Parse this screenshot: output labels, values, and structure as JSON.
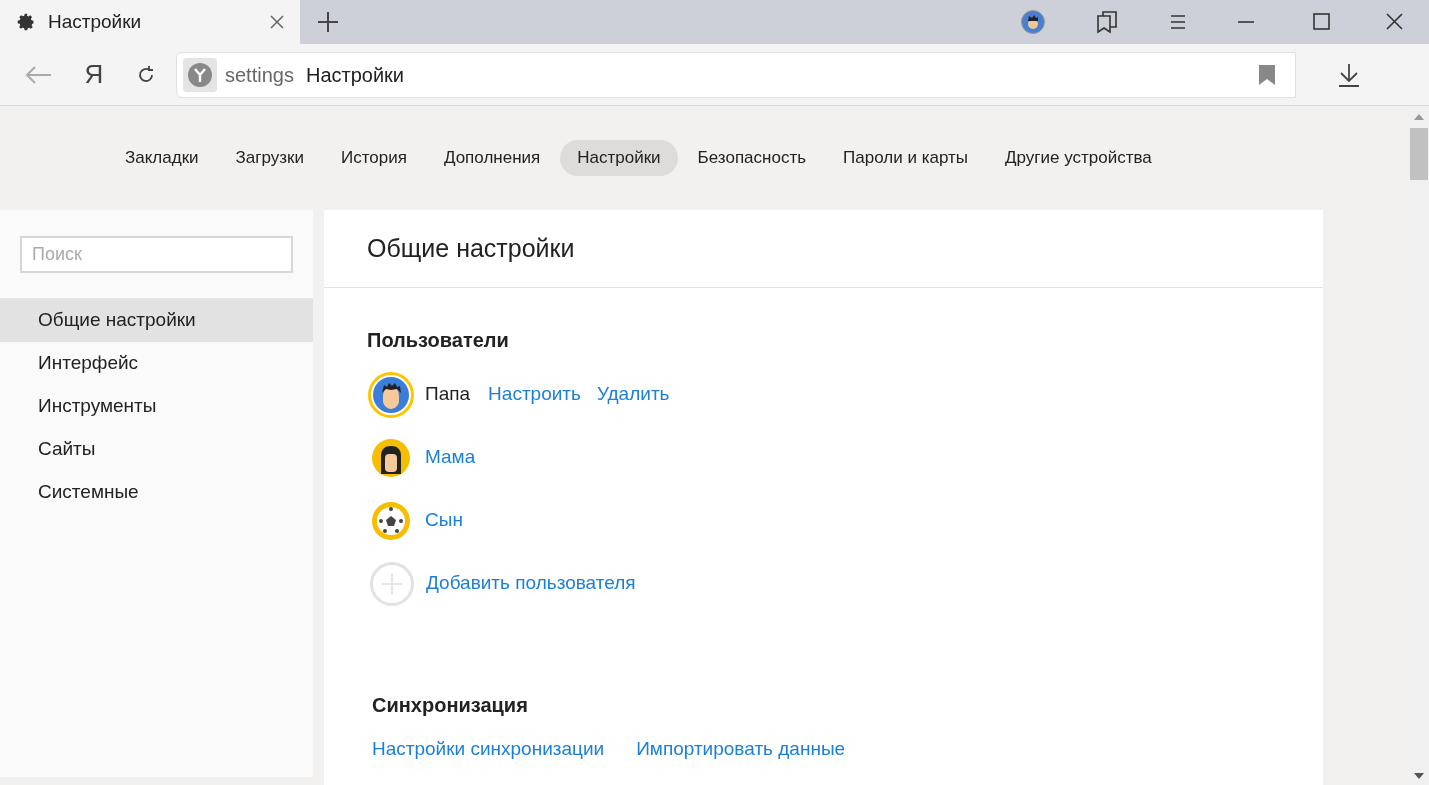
{
  "tab": {
    "title": "Настройки"
  },
  "toolbar": {
    "logo_letter": "Я",
    "address_scheme": "settings",
    "address_title": "Настройки"
  },
  "nav": [
    {
      "label": "Закладки",
      "selected": false
    },
    {
      "label": "Загрузки",
      "selected": false
    },
    {
      "label": "История",
      "selected": false
    },
    {
      "label": "Дополнения",
      "selected": false
    },
    {
      "label": "Настройки",
      "selected": true
    },
    {
      "label": "Безопасность",
      "selected": false
    },
    {
      "label": "Пароли и карты",
      "selected": false
    },
    {
      "label": "Другие устройства",
      "selected": false
    }
  ],
  "sidebar": {
    "search_placeholder": "Поиск",
    "items": [
      {
        "label": "Общие настройки",
        "selected": true
      },
      {
        "label": "Интерфейс",
        "selected": false
      },
      {
        "label": "Инструменты",
        "selected": false
      },
      {
        "label": "Сайты",
        "selected": false
      },
      {
        "label": "Системные",
        "selected": false
      }
    ]
  },
  "main": {
    "title": "Общие настройки",
    "users_heading": "Пользователи",
    "users": [
      {
        "name": "Папа",
        "kind": "man",
        "current": true,
        "actions": [
          "Настроить",
          "Удалить"
        ]
      },
      {
        "name": "Мама",
        "kind": "woman",
        "current": false
      },
      {
        "name": "Сын",
        "kind": "ball",
        "current": false
      }
    ],
    "add_user": "Добавить пользователя",
    "sync_heading": "Синхронизация",
    "sync_links": [
      "Настройки синхронизации",
      "Импортировать данные"
    ]
  }
}
